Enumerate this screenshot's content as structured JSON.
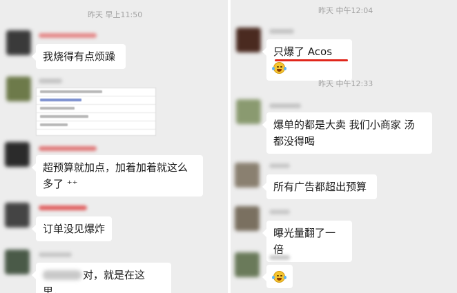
{
  "left": {
    "timestamp": "昨天 早上11:50",
    "messages": [
      {
        "text": "我烧得有点烦躁"
      },
      {
        "text_line1": "超预算就加点，加着加着就这么",
        "text_line2": "多了 ⁺⁺"
      },
      {
        "text": "订单没见爆炸"
      },
      {
        "text": "对，就是在这里，"
      }
    ]
  },
  "right": {
    "timestamp1": "昨天 中午12:04",
    "timestamp2": "昨天 中午12:33",
    "messages": [
      {
        "text": "只爆了 Acos"
      },
      {
        "text_line1": "爆单的都是大卖  我们小商家  汤",
        "text_line2": "都没得喝"
      },
      {
        "text": "所有广告都超出预算"
      },
      {
        "text": "曝光量翻了一倍"
      }
    ]
  },
  "colors": {
    "chat_background": "#ededed",
    "bubble": "#ffffff",
    "highlight_underline": "#e0261b"
  },
  "icons": [
    "laughing-with-tears-emoji",
    "blurred-avatar",
    "spreadsheet-screenshot"
  ]
}
